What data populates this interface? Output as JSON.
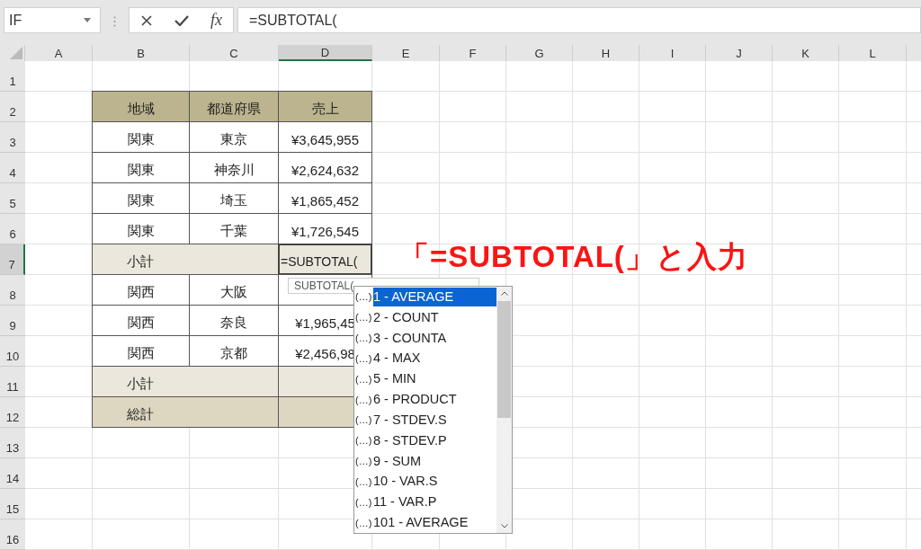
{
  "name_box": {
    "value": "IF"
  },
  "formula_bar": {
    "function_label": "fx",
    "value": "=SUBTOTAL("
  },
  "columns": [
    {
      "label": "A",
      "selected": false
    },
    {
      "label": "B",
      "selected": false
    },
    {
      "label": "C",
      "selected": false
    },
    {
      "label": "D",
      "selected": true
    },
    {
      "label": "E",
      "selected": false
    },
    {
      "label": "F",
      "selected": false
    },
    {
      "label": "G",
      "selected": false
    },
    {
      "label": "H",
      "selected": false
    },
    {
      "label": "I",
      "selected": false
    },
    {
      "label": "J",
      "selected": false
    },
    {
      "label": "K",
      "selected": false
    },
    {
      "label": "L",
      "selected": false
    }
  ],
  "rows": [
    {
      "label": "1",
      "selected": false
    },
    {
      "label": "2",
      "selected": false
    },
    {
      "label": "3",
      "selected": false
    },
    {
      "label": "4",
      "selected": false
    },
    {
      "label": "5",
      "selected": false
    },
    {
      "label": "6",
      "selected": false
    },
    {
      "label": "7",
      "selected": true
    },
    {
      "label": "8",
      "selected": false
    },
    {
      "label": "9",
      "selected": false
    },
    {
      "label": "10",
      "selected": false
    },
    {
      "label": "11",
      "selected": false
    },
    {
      "label": "12",
      "selected": false
    },
    {
      "label": "13",
      "selected": false
    },
    {
      "label": "14",
      "selected": false
    },
    {
      "label": "15",
      "selected": false
    },
    {
      "label": "16",
      "selected": false
    }
  ],
  "table": {
    "header": [
      "地域",
      "都道府県",
      "売上"
    ],
    "rows": [
      {
        "kind": "data",
        "cells": [
          "関東",
          "東京",
          "¥3,645,955"
        ]
      },
      {
        "kind": "data",
        "cells": [
          "関東",
          "神奈川",
          "¥2,624,632"
        ]
      },
      {
        "kind": "data",
        "cells": [
          "関東",
          "埼玉",
          "¥1,865,452"
        ]
      },
      {
        "kind": "data",
        "cells": [
          "関東",
          "千葉",
          "¥1,726,545"
        ]
      },
      {
        "kind": "subtotal",
        "label": "小計",
        "value": "=SUBTOTAL(",
        "active": true
      },
      {
        "kind": "data",
        "cells": [
          "関西",
          "大阪"
        ]
      },
      {
        "kind": "data",
        "cells": [
          "関西",
          "奈良",
          "¥1,965,45"
        ]
      },
      {
        "kind": "data",
        "cells": [
          "関西",
          "京都",
          "¥2,456,98"
        ]
      },
      {
        "kind": "subtotal",
        "label": "小計",
        "active": false
      },
      {
        "kind": "total",
        "label": "総計",
        "active": false
      }
    ]
  },
  "tooltip": {
    "text": "SUBTOTAL("
  },
  "dropdown": {
    "items": [
      {
        "prefix": "(…)",
        "label": "1 - AVERAGE",
        "selected": true
      },
      {
        "prefix": "(…)",
        "label": "2 - COUNT",
        "selected": false
      },
      {
        "prefix": "(…)",
        "label": "3 - COUNTA",
        "selected": false
      },
      {
        "prefix": "(…)",
        "label": "4 - MAX",
        "selected": false
      },
      {
        "prefix": "(…)",
        "label": "5 - MIN",
        "selected": false
      },
      {
        "prefix": "(…)",
        "label": "6 - PRODUCT",
        "selected": false
      },
      {
        "prefix": "(…)",
        "label": "7 - STDEV.S",
        "selected": false
      },
      {
        "prefix": "(…)",
        "label": "8 - STDEV.P",
        "selected": false
      },
      {
        "prefix": "(…)",
        "label": "9 - SUM",
        "selected": false
      },
      {
        "prefix": "(…)",
        "label": "10 - VAR.S",
        "selected": false
      },
      {
        "prefix": "(…)",
        "label": "11 - VAR.P",
        "selected": false
      },
      {
        "prefix": "(…)",
        "label": "101 - AVERAGE",
        "selected": false
      }
    ]
  },
  "annotation": {
    "text": "「=SUBTOTAL(」と入力"
  }
}
